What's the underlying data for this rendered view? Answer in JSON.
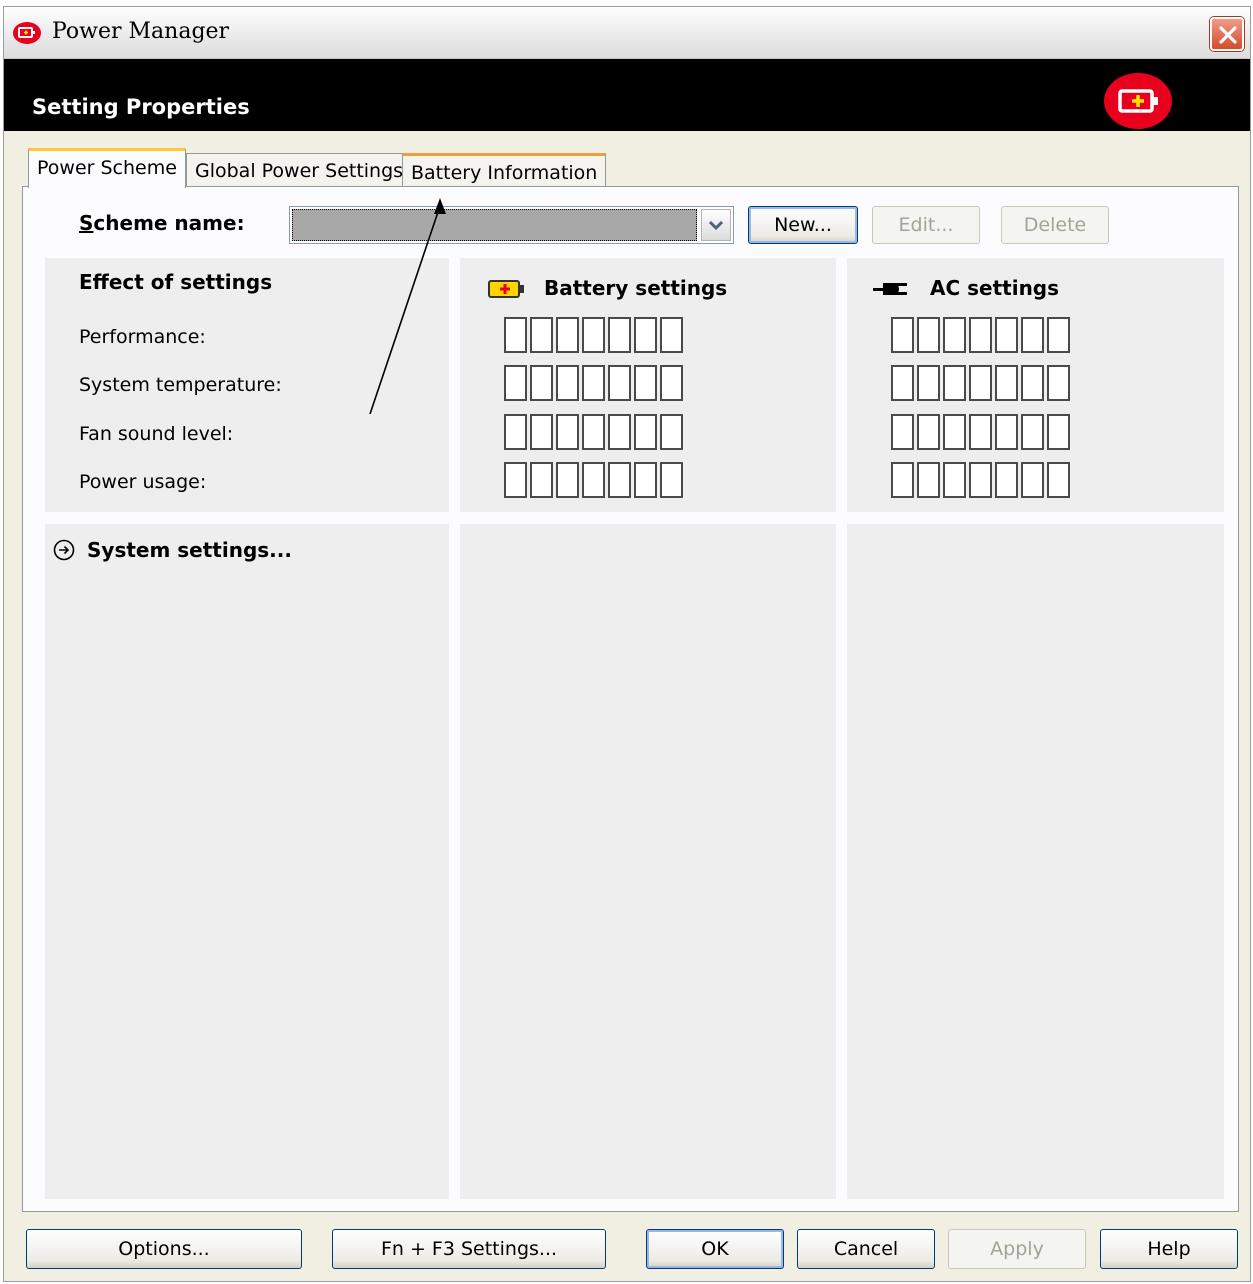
{
  "window": {
    "title": "Power Manager",
    "header_title": "Setting Properties"
  },
  "tabs": [
    {
      "label": "Power Scheme"
    },
    {
      "label": "Global Power Settings"
    },
    {
      "label": "Battery Information"
    }
  ],
  "scheme": {
    "label_prefix": "S",
    "label_rest": "cheme name:",
    "selected_value": "",
    "new_label": "New...",
    "edit_label": "Edit...",
    "delete_label": "Delete"
  },
  "effects": {
    "title": "Effect of settings",
    "rows": [
      {
        "label": "Performance:"
      },
      {
        "label": "System temperature:"
      },
      {
        "label": "Fan sound level:"
      },
      {
        "label": "Power usage:"
      }
    ]
  },
  "battery": {
    "title": "Battery settings"
  },
  "ac": {
    "title": "AC settings"
  },
  "system_settings_link": "System settings...",
  "footer": {
    "options": "Options...",
    "fn_f3": "Fn + F3 Settings...",
    "ok": "OK",
    "cancel": "Cancel",
    "apply": "Apply",
    "help": "Help"
  },
  "colors": {
    "brand_red": "#e8001c",
    "header_bg": "#000000",
    "panel_bg": "#eeeeee"
  }
}
